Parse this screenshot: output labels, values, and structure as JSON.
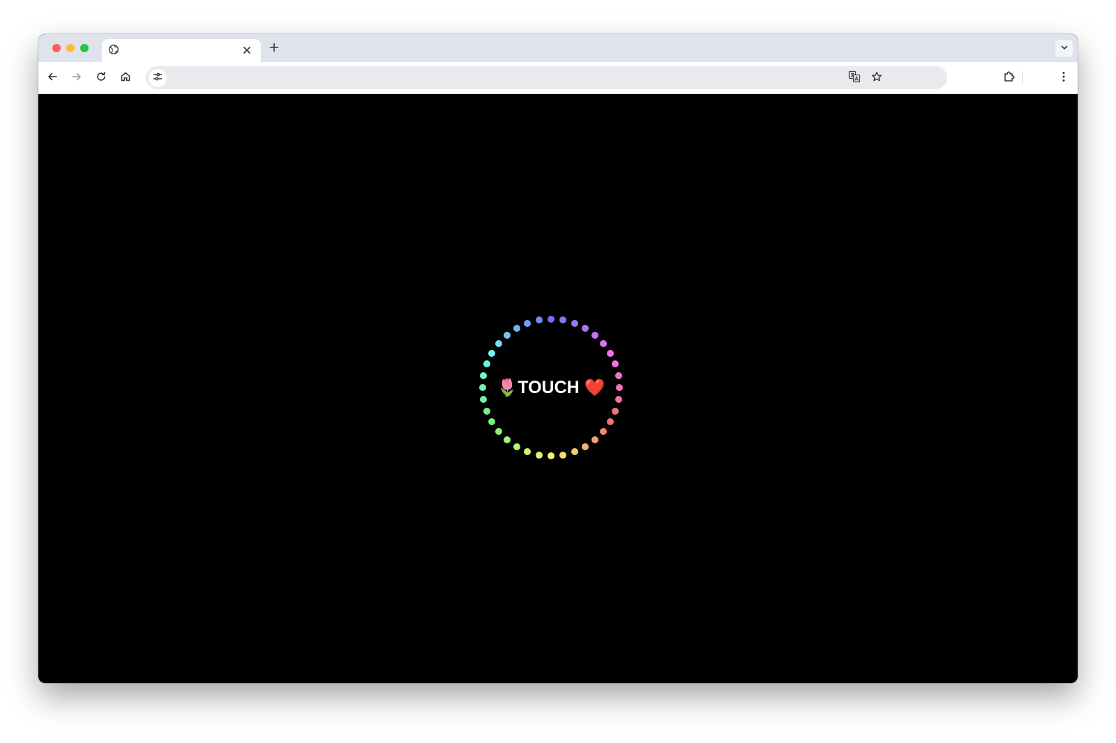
{
  "browser": {
    "tab": {
      "title": "",
      "favicon_icon": "globe-icon",
      "close_icon": "close-icon"
    },
    "new_tab_icon": "plus-icon",
    "tab_search_icon": "chevron-down-icon",
    "toolbar": {
      "back_icon": "arrow-left-icon",
      "forward_icon": "arrow-right-icon",
      "reload_icon": "reload-icon",
      "home_icon": "home-icon",
      "site_info_icon": "tune-icon",
      "url_value": "",
      "translate_icon": "translate-icon",
      "bookmark_icon": "star-icon",
      "extensions_icon": "puzzle-icon",
      "menu_icon": "kebab-menu-icon"
    },
    "traffic_lights": {
      "close_color": "#fe5f57",
      "minimize_color": "#febc2e",
      "maximize_color": "#28c840"
    }
  },
  "page": {
    "background": "#000000",
    "touch_button": {
      "leading_emoji": "🌷",
      "label": "TOUCH",
      "trailing_emoji": "❤️",
      "leading_icon": "tulip-icon",
      "trailing_icon": "heart-icon"
    },
    "ring": {
      "dot_count": 36,
      "colors": "rainbow"
    }
  }
}
